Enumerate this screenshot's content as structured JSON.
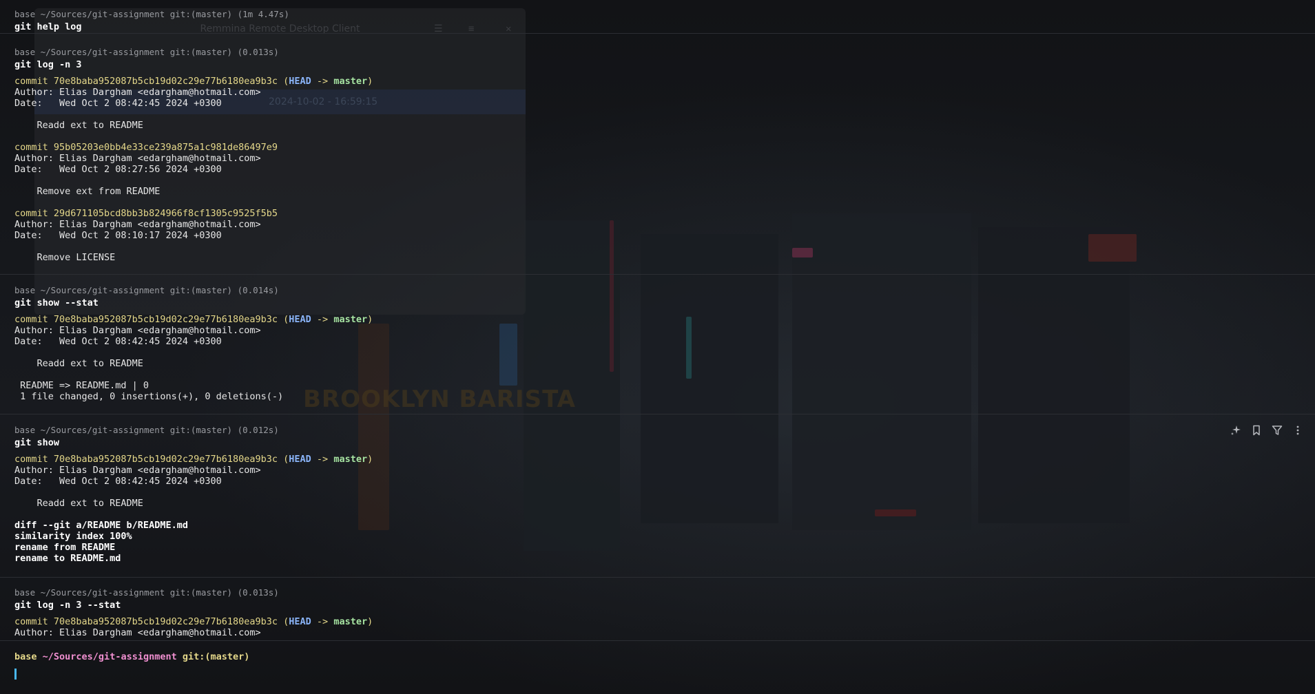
{
  "remmina": {
    "title": "Remmina Remote Desktop Client",
    "selected_date": "2024-10-02 - 16:59:15"
  },
  "blocks": [
    {
      "meta": "base ~/Sources/git-assignment git:(master) (1m 4.47s)",
      "command": "git help log"
    },
    {
      "meta": "base ~/Sources/git-assignment git:(master) (0.013s)",
      "command": "git log -n 3",
      "commits": [
        {
          "commit_label": "commit 70e8baba952087b5cb19d02c29e77b6180ea9b3c",
          "ref_open": " (",
          "head": "HEAD",
          "arrow": " -> ",
          "branch": "master",
          "ref_close": ")",
          "author": "Author: Elias Dargham <edargham@hotmail.com>",
          "date": "Date:   Wed Oct 2 08:42:45 2024 +0300",
          "message": "    Readd ext to README"
        },
        {
          "commit_label": "commit 95b05203e0bb4e33ce239a875a1c981de86497e9",
          "author": "Author: Elias Dargham <edargham@hotmail.com>",
          "date": "Date:   Wed Oct 2 08:27:56 2024 +0300",
          "message": "    Remove ext from README"
        },
        {
          "commit_label": "commit 29d671105bcd8bb3b824966f8cf1305c9525f5b5",
          "author": "Author: Elias Dargham <edargham@hotmail.com>",
          "date": "Date:   Wed Oct 2 08:10:17 2024 +0300",
          "message": "    Remove LICENSE"
        }
      ]
    },
    {
      "meta": "base ~/Sources/git-assignment git:(master) (0.014s)",
      "command": "git show --stat",
      "commit_label": "commit 70e8baba952087b5cb19d02c29e77b6180ea9b3c",
      "ref_open": " (",
      "head": "HEAD",
      "arrow": " -> ",
      "branch": "master",
      "ref_close": ")",
      "author": "Author: Elias Dargham <edargham@hotmail.com>",
      "date": "Date:   Wed Oct 2 08:42:45 2024 +0300",
      "message": "    Readd ext to README",
      "stat_line": " README => README.md | 0",
      "summary": " 1 file changed, 0 insertions(+), 0 deletions(-)"
    },
    {
      "meta": "base ~/Sources/git-assignment git:(master) (0.012s)",
      "command": "git show",
      "commit_label": "commit 70e8baba952087b5cb19d02c29e77b6180ea9b3c",
      "ref_open": " (",
      "head": "HEAD",
      "arrow": " -> ",
      "branch": "master",
      "ref_close": ")",
      "author": "Author: Elias Dargham <edargham@hotmail.com>",
      "date": "Date:   Wed Oct 2 08:42:45 2024 +0300",
      "message": "    Readd ext to README",
      "diff_header": "diff --git a/README b/README.md",
      "similarity": "similarity index 100%",
      "rename_from": "rename from README",
      "rename_to": "rename to README.md"
    },
    {
      "meta": "base ~/Sources/git-assignment git:(master) (0.013s)",
      "command": "git log -n 3 --stat",
      "commit_label": "commit 70e8baba952087b5cb19d02c29e77b6180ea9b3c",
      "ref_open": " (",
      "head": "HEAD",
      "arrow": " -> ",
      "branch": "master",
      "ref_close": ")",
      "author": "Author: Elias Dargham <edargham@hotmail.com>"
    }
  ],
  "active_prompt": {
    "env": "base",
    "path": "~/Sources/git-assignment",
    "git": "git:(master)"
  },
  "block_toolbar": {
    "icons": [
      "ai-sparkle-icon",
      "bookmark-icon",
      "filter-icon",
      "more-vertical-icon"
    ]
  },
  "colors": {
    "commit_hash": "#e5d88a",
    "head_ref": "#8ab4f8",
    "branch": "#a6e3a1",
    "path": "#f08fd0",
    "cursor": "#49b8f2"
  },
  "background_text": {
    "sign": "BROOKLYN BARISTA"
  }
}
